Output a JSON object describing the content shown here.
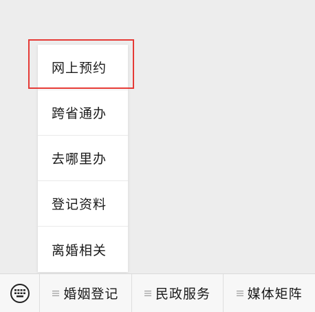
{
  "popup_menu": {
    "items": [
      {
        "label": "网上预约"
      },
      {
        "label": "跨省通办"
      },
      {
        "label": "去哪里办"
      },
      {
        "label": "登记资料"
      },
      {
        "label": "离婚相关"
      }
    ],
    "highlighted_index": 0,
    "highlight_color": "#e53935"
  },
  "bottom_menu": {
    "keyboard_icon": "keyboard-icon",
    "tabs": [
      {
        "label": "婚姻登记",
        "icon": "menu-lines-icon"
      },
      {
        "label": "民政服务",
        "icon": "menu-lines-icon"
      },
      {
        "label": "媒体矩阵",
        "icon": "menu-lines-icon"
      }
    ]
  }
}
